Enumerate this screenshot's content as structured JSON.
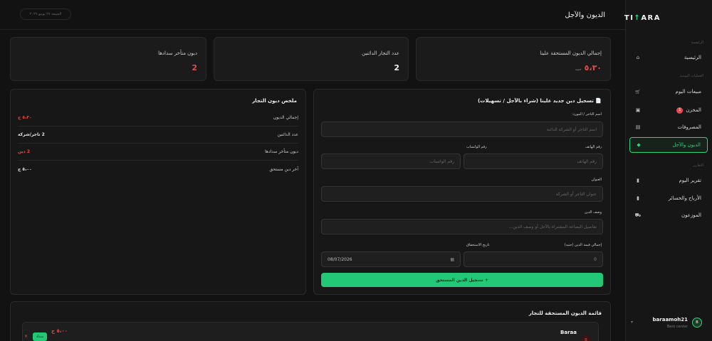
{
  "app": {
    "logo_pre": "TI",
    "logo_mid": "↑",
    "logo_post": "ARA"
  },
  "header": {
    "title": "الديون والآجل",
    "date": "الجمعة ٢٧ يونيو ٢٠٢٦"
  },
  "sidebar": {
    "sections": [
      "الرئيسية",
      "العمليات اليومية",
      "التقارير"
    ],
    "items": [
      {
        "label": "الرئيسية",
        "icon": "home-icon",
        "glyph": "⌂"
      },
      {
        "label": "مبيعات اليوم",
        "icon": "cart-icon",
        "glyph": "🛒"
      },
      {
        "label": "المخزن",
        "icon": "box-icon",
        "glyph": "▣",
        "badge": "1"
      },
      {
        "label": "المصروفات",
        "icon": "receipt-icon",
        "glyph": "▤"
      },
      {
        "label": "الديون والآجل",
        "icon": "diamond-icon",
        "glyph": "◆"
      },
      {
        "label": "تقرير اليوم",
        "icon": "bar-chart-icon",
        "glyph": "▮"
      },
      {
        "label": "الأرباح والخسائر",
        "icon": "trend-icon",
        "glyph": "▮"
      },
      {
        "label": "الموزعون",
        "icon": "truck-icon",
        "glyph": "⛟"
      }
    ],
    "user": {
      "name": "baraamoh21",
      "role": "Bero center",
      "initial": "B"
    }
  },
  "stats": [
    {
      "label": "إجمالي الديون المستحقة علينا",
      "value": "٥،٣٠",
      "unit": "جنيه",
      "color": "#e24b4b"
    },
    {
      "label": "عدد التجار الدائنين",
      "value": "2",
      "unit": "",
      "color": "#f0f0f0"
    },
    {
      "label": "ديون متأخر سدادها",
      "value": "2",
      "unit": "",
      "color": "#e24b4b"
    }
  ],
  "form": {
    "title": "📄 تسجيل دين جديد علينا (شراء بالآجل / تسهيلات)",
    "merchant_label": "اسم التاجر / المورد:",
    "merchant_placeholder": "اسم التاجر أو الشركة الدائنة",
    "phone_label": "رقم الهاتف",
    "phone_placeholder": "رقم الهاتف",
    "whatsapp_label": "رقم الواتساب",
    "whatsapp_placeholder": "رقم الواتساب",
    "address_label": "العنوان",
    "address_placeholder": "عنوان التاجر أو الشركة",
    "desc_label": "وصف الدين",
    "desc_placeholder": "تفاصيل البضاعة المشتراة بالآجل أو وصف الدين...",
    "amount_label": "إجمالي قيمة الدين (جنيه)",
    "amount_value": "0",
    "due_label": "تاريخ الاستحقاق",
    "due_value": "08/07/2026",
    "submit": "+ تسجيل الدين المستحق"
  },
  "summary": {
    "title": "ملخص ديون التجار",
    "rows": [
      {
        "label": "إجمالي الديون",
        "value": "٥،٣٠ ج",
        "red": true
      },
      {
        "label": "عدد الدائنين",
        "value": "2 تاجر/شركة",
        "red": false
      },
      {
        "label": "ديون متأخر سدادها",
        "value": "2 دين",
        "red": true
      },
      {
        "label": "آخر دين مستحق",
        "value": "٥،٠٠ ج",
        "red": false
      }
    ]
  },
  "debts": {
    "title": "قائمة الديون المستحقة للتجار",
    "items": [
      {
        "name": "Baraa",
        "initial": "B",
        "amount": "٥،٠٠ ج",
        "pay": "سداد",
        "delete": "✕"
      }
    ]
  }
}
